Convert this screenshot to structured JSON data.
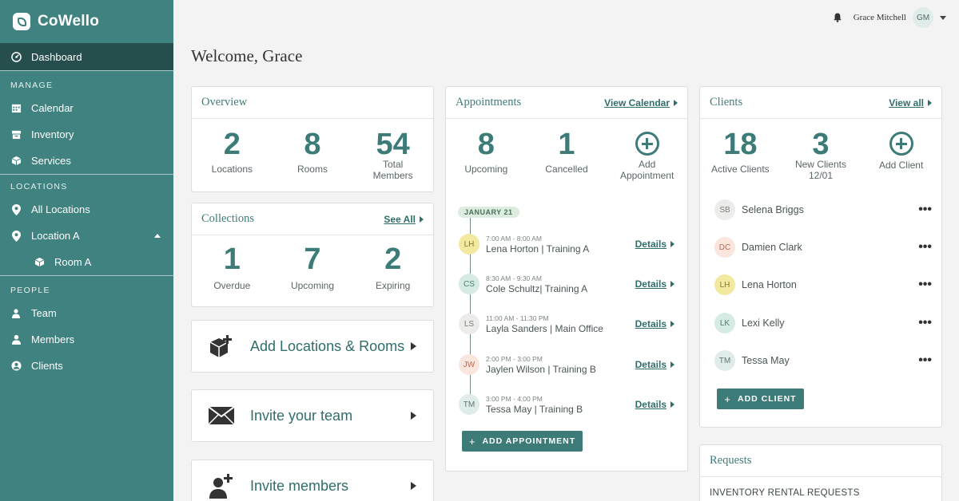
{
  "app": {
    "name": "CoWello"
  },
  "user": {
    "name": "Grace Mitchell",
    "initials": "GM"
  },
  "sidebar": {
    "dashboard": "Dashboard",
    "manage_head": "MANAGE",
    "manage": [
      "Calendar",
      "Inventory",
      "Services"
    ],
    "locations_head": "LOCATIONS",
    "all_locations": "All Locations",
    "location_a": "Location A",
    "room_a": "Room A",
    "people_head": "PEOPLE",
    "people": [
      "Team",
      "Members",
      "Clients"
    ]
  },
  "welcome": "Welcome, Grace",
  "overview": {
    "title": "Overview",
    "stats": [
      {
        "value": "2",
        "label": "Locations"
      },
      {
        "value": "8",
        "label": "Rooms"
      },
      {
        "value": "54",
        "label": "Total Members"
      }
    ]
  },
  "collections": {
    "title": "Collections",
    "link": "See All",
    "stats": [
      {
        "value": "1",
        "label": "Overdue"
      },
      {
        "value": "7",
        "label": "Upcoming"
      },
      {
        "value": "2",
        "label": "Expiring"
      }
    ]
  },
  "actions": {
    "add_locations": "Add Locations & Rooms",
    "invite_team": "Invite your team",
    "invite_members": "Invite members"
  },
  "appointments": {
    "title": "Appointments",
    "link": "View Calendar",
    "stats": [
      {
        "value": "8",
        "label": "Upcoming"
      },
      {
        "value": "1",
        "label": "Cancelled"
      }
    ],
    "add_label": "Add Appointment",
    "date": "JANUARY 21",
    "details_label": "Details",
    "items": [
      {
        "initials": "LH",
        "time": "7:00 AM - 8:00 AM",
        "name": "Lena Horton | Training A"
      },
      {
        "initials": "CS",
        "time": "8:30 AM - 9:30 AM",
        "name": "Cole Schultz| Training A"
      },
      {
        "initials": "LS",
        "time": "11:00 AM - 11:30 PM",
        "name": "Layla Sanders | Main Office"
      },
      {
        "initials": "JW",
        "time": "2:00 PM - 3:00 PM",
        "name": "Jaylen Wilson | Training B"
      },
      {
        "initials": "TM",
        "time": "3:00 PM - 4:00 PM",
        "name": "Tessa May | Training B"
      }
    ],
    "button": "ADD APPOINTMENT"
  },
  "clients": {
    "title": "Clients",
    "link": "View all",
    "stats": [
      {
        "value": "18",
        "label": "Active Clients"
      },
      {
        "value": "3",
        "label": "New Clients 12/01"
      }
    ],
    "add_label": "Add Client",
    "items": [
      {
        "initials": "SB",
        "name": "Selena Briggs"
      },
      {
        "initials": "DC",
        "name": "Damien Clark"
      },
      {
        "initials": "LH",
        "name": "Lena Horton"
      },
      {
        "initials": "LK",
        "name": "Lexi Kelly"
      },
      {
        "initials": "TM",
        "name": "Tessa May"
      }
    ],
    "menu_glyph": "•••",
    "button": "ADD CLIENT"
  },
  "requests": {
    "title": "Requests",
    "subhead": "INVENTORY RENTAL REQUESTS"
  }
}
